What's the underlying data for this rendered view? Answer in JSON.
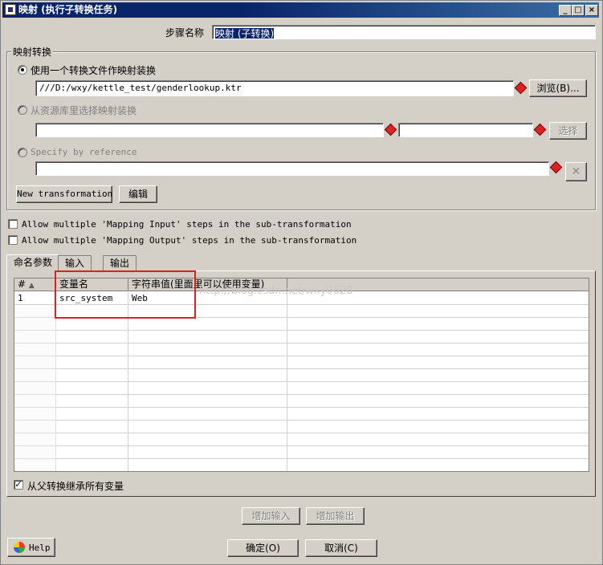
{
  "window": {
    "title": "映射 (执行子转换任务)",
    "buttons": {
      "minimize": "_",
      "maximize": "□",
      "close": "×"
    }
  },
  "step_name": {
    "label": "步骤名称",
    "value": "映射 (子转换)"
  },
  "mapping_group": {
    "title": "映射转换",
    "option_file": {
      "label": "使用一个转换文件作映射装换",
      "path": "///D:/wxy/kettle_test/genderlookup.ktr",
      "browse": "浏览(B)...",
      "selected": true
    },
    "option_repo": {
      "label": "从资源库里选择映射装换",
      "dir_value": "",
      "name_value": "",
      "select": "选择"
    },
    "option_ref": {
      "label": "Specify by reference",
      "value": ""
    },
    "new_transformation": "New transformation",
    "edit": "编辑"
  },
  "checkboxes": {
    "multi_input": {
      "label": "Allow multiple 'Mapping Input' steps in the sub-transformation",
      "checked": false
    },
    "multi_output": {
      "label": "Allow multiple 'Mapping Output' steps in the sub-transformation",
      "checked": false
    }
  },
  "tabs": [
    "命名参数",
    "输入",
    "输出"
  ],
  "grid": {
    "headers": [
      "#",
      "变量名",
      "字符串值(里面里可以使用变量)"
    ],
    "rows": [
      {
        "num": "1",
        "name": "src_system",
        "value": "Web"
      }
    ],
    "watermark": "http://blog.csdn.net/wxy0628"
  },
  "inherit_all": {
    "label": "从父转换继承所有变量",
    "checked": true
  },
  "buttons": {
    "add_input": "增加输入",
    "add_output": "增加输出",
    "help": "Help",
    "ok": "确定(O)",
    "cancel": "取消(C)"
  }
}
